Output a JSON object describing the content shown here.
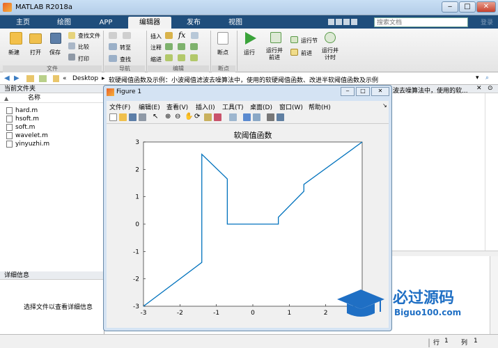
{
  "window": {
    "title": "MATLAB R2018a"
  },
  "tabs": [
    {
      "label": "主页"
    },
    {
      "label": "绘图"
    },
    {
      "label": "APP"
    },
    {
      "label": "编辑器",
      "active": true
    },
    {
      "label": "发布"
    },
    {
      "label": "视图"
    }
  ],
  "search": {
    "placeholder": "搜索文档",
    "signin": "登录"
  },
  "ribbon": {
    "file": {
      "new": "新建",
      "open": "打开",
      "save": "保存",
      "find_files": "查找文件",
      "compare": "比较",
      "print": "打印",
      "group": "文件"
    },
    "navigate": {
      "goto": "转至",
      "find": "查找",
      "group": "导航"
    },
    "edit": {
      "insert": "插入",
      "comment": "注释",
      "indent": "缩进",
      "fx": "fx",
      "group": "编辑"
    },
    "breakpoints": {
      "label": "断点",
      "group": "断点"
    },
    "run": {
      "run": "运行",
      "run_advance": "运行并\n前进",
      "run_section": "运行节",
      "advance": "前进",
      "run_time": "运行并\n计时"
    }
  },
  "path": {
    "segments": [
      "«",
      "Desktop",
      "▸",
      "软硬阈值函数及示例：小波阈值滤波去噪算法中，使用的软硬阈值函数、改进半软阈值函数及示例"
    ],
    "overflow": "▾"
  },
  "current_folder": {
    "title": "当前文件夹",
    "column": "名称",
    "files": [
      "hard.m",
      "hsoft.m",
      "soft.m",
      "wavelet.m",
      "yinyuzhi.m"
    ]
  },
  "details": {
    "title": "详细信息",
    "hint": "选择文件以查看详细信息"
  },
  "right_pane": {
    "header_text": "波去噪算法中，使用的软..."
  },
  "status": {
    "row_label": "行",
    "row": "1",
    "col_label": "列",
    "col": "1"
  },
  "figure": {
    "title": "Figure 1",
    "menu": [
      "文件(F)",
      "编辑(E)",
      "查看(V)",
      "插入(I)",
      "工具(T)",
      "桌面(D)",
      "窗口(W)",
      "帮助(H)"
    ]
  },
  "chart_data": {
    "type": "line",
    "title": "软阈值函数",
    "xlabel": "",
    "ylabel": "",
    "xlim": [
      -3,
      3
    ],
    "ylim": [
      -3,
      3
    ],
    "xticks": [
      -3,
      -2,
      -1,
      0,
      1,
      2,
      3
    ],
    "yticks": [
      -3,
      -2,
      -1,
      0,
      1,
      2,
      3
    ],
    "grid": false,
    "line_color": "#0072bd",
    "series": [
      {
        "x": [
          -3,
          -1.4,
          -1.4,
          -0.7,
          -0.7,
          0,
          0.7,
          0.7,
          1.4,
          1.4,
          3
        ],
        "y": [
          -3,
          -1.4,
          2.55,
          1.65,
          0,
          0,
          0,
          0.25,
          1.2,
          1.45,
          3
        ]
      }
    ]
  },
  "watermark": {
    "brand": "必过源码",
    "site": "Biguo100.com"
  }
}
